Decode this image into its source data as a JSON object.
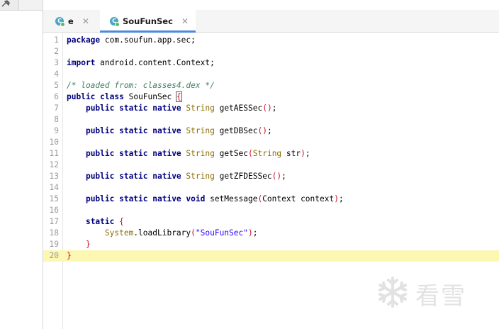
{
  "tabs": [
    {
      "label": "e",
      "active": false,
      "icon": "class-icon"
    },
    {
      "label": "SouFunSec",
      "active": true,
      "icon": "class-icon"
    }
  ],
  "editor": {
    "current_line": 20,
    "lines": [
      {
        "n": "1",
        "tokens": [
          {
            "t": "package",
            "c": "kw"
          },
          {
            "t": " com.soufun.app.sec;"
          }
        ]
      },
      {
        "n": "2",
        "tokens": []
      },
      {
        "n": "3",
        "tokens": [
          {
            "t": "import",
            "c": "kw"
          },
          {
            "t": " android.content.Context;"
          }
        ]
      },
      {
        "n": "4",
        "tokens": []
      },
      {
        "n": "5",
        "tokens": [
          {
            "t": "/* loaded from: classes4.dex */",
            "c": "cm"
          }
        ]
      },
      {
        "n": "6",
        "tokens": [
          {
            "t": "public",
            "c": "kw"
          },
          {
            "t": " "
          },
          {
            "t": "class",
            "c": "kw"
          },
          {
            "t": " SouFunSec "
          },
          {
            "t": "{",
            "c": "br cursor-br"
          }
        ]
      },
      {
        "n": "7",
        "tokens": [
          {
            "t": "    "
          },
          {
            "t": "public static native",
            "c": "kw"
          },
          {
            "t": " "
          },
          {
            "t": "String",
            "c": "type"
          },
          {
            "t": " getAESSec"
          },
          {
            "t": "()",
            "c": "br"
          },
          {
            "t": ";"
          }
        ]
      },
      {
        "n": "8",
        "tokens": []
      },
      {
        "n": "9",
        "tokens": [
          {
            "t": "    "
          },
          {
            "t": "public static native",
            "c": "kw"
          },
          {
            "t": " "
          },
          {
            "t": "String",
            "c": "type"
          },
          {
            "t": " getDBSec"
          },
          {
            "t": "()",
            "c": "br"
          },
          {
            "t": ";"
          }
        ]
      },
      {
        "n": "10",
        "tokens": []
      },
      {
        "n": "11",
        "tokens": [
          {
            "t": "    "
          },
          {
            "t": "public static native",
            "c": "kw"
          },
          {
            "t": " "
          },
          {
            "t": "String",
            "c": "type"
          },
          {
            "t": " getSec"
          },
          {
            "t": "(",
            "c": "br"
          },
          {
            "t": "String",
            "c": "type"
          },
          {
            "t": " str"
          },
          {
            "t": ")",
            "c": "br"
          },
          {
            "t": ";"
          }
        ]
      },
      {
        "n": "12",
        "tokens": []
      },
      {
        "n": "13",
        "tokens": [
          {
            "t": "    "
          },
          {
            "t": "public static native",
            "c": "kw"
          },
          {
            "t": " "
          },
          {
            "t": "String",
            "c": "type"
          },
          {
            "t": " getZFDESSec"
          },
          {
            "t": "()",
            "c": "br"
          },
          {
            "t": ";"
          }
        ]
      },
      {
        "n": "14",
        "tokens": []
      },
      {
        "n": "15",
        "tokens": [
          {
            "t": "    "
          },
          {
            "t": "public static native void",
            "c": "kw"
          },
          {
            "t": " setMessage"
          },
          {
            "t": "(",
            "c": "br"
          },
          {
            "t": "Context context"
          },
          {
            "t": ")",
            "c": "br"
          },
          {
            "t": ";"
          }
        ]
      },
      {
        "n": "16",
        "tokens": []
      },
      {
        "n": "17",
        "tokens": [
          {
            "t": "    "
          },
          {
            "t": "static",
            "c": "kw"
          },
          {
            "t": " "
          },
          {
            "t": "{",
            "c": "br"
          }
        ]
      },
      {
        "n": "18",
        "tokens": [
          {
            "t": "        "
          },
          {
            "t": "System",
            "c": "type"
          },
          {
            "t": ".loadLibrary"
          },
          {
            "t": "(",
            "c": "br"
          },
          {
            "t": "\"SouFunSec\"",
            "c": "str"
          },
          {
            "t": ")",
            "c": "br"
          },
          {
            "t": ";"
          }
        ]
      },
      {
        "n": "19",
        "tokens": [
          {
            "t": "    "
          },
          {
            "t": "}",
            "c": "br"
          }
        ]
      },
      {
        "n": "20",
        "tokens": [
          {
            "t": "}",
            "c": "br"
          }
        ]
      }
    ]
  },
  "watermark": {
    "text": "看雪",
    "icon": "snowflake-icon"
  },
  "toolbar": {
    "icon": "pin-icon"
  }
}
